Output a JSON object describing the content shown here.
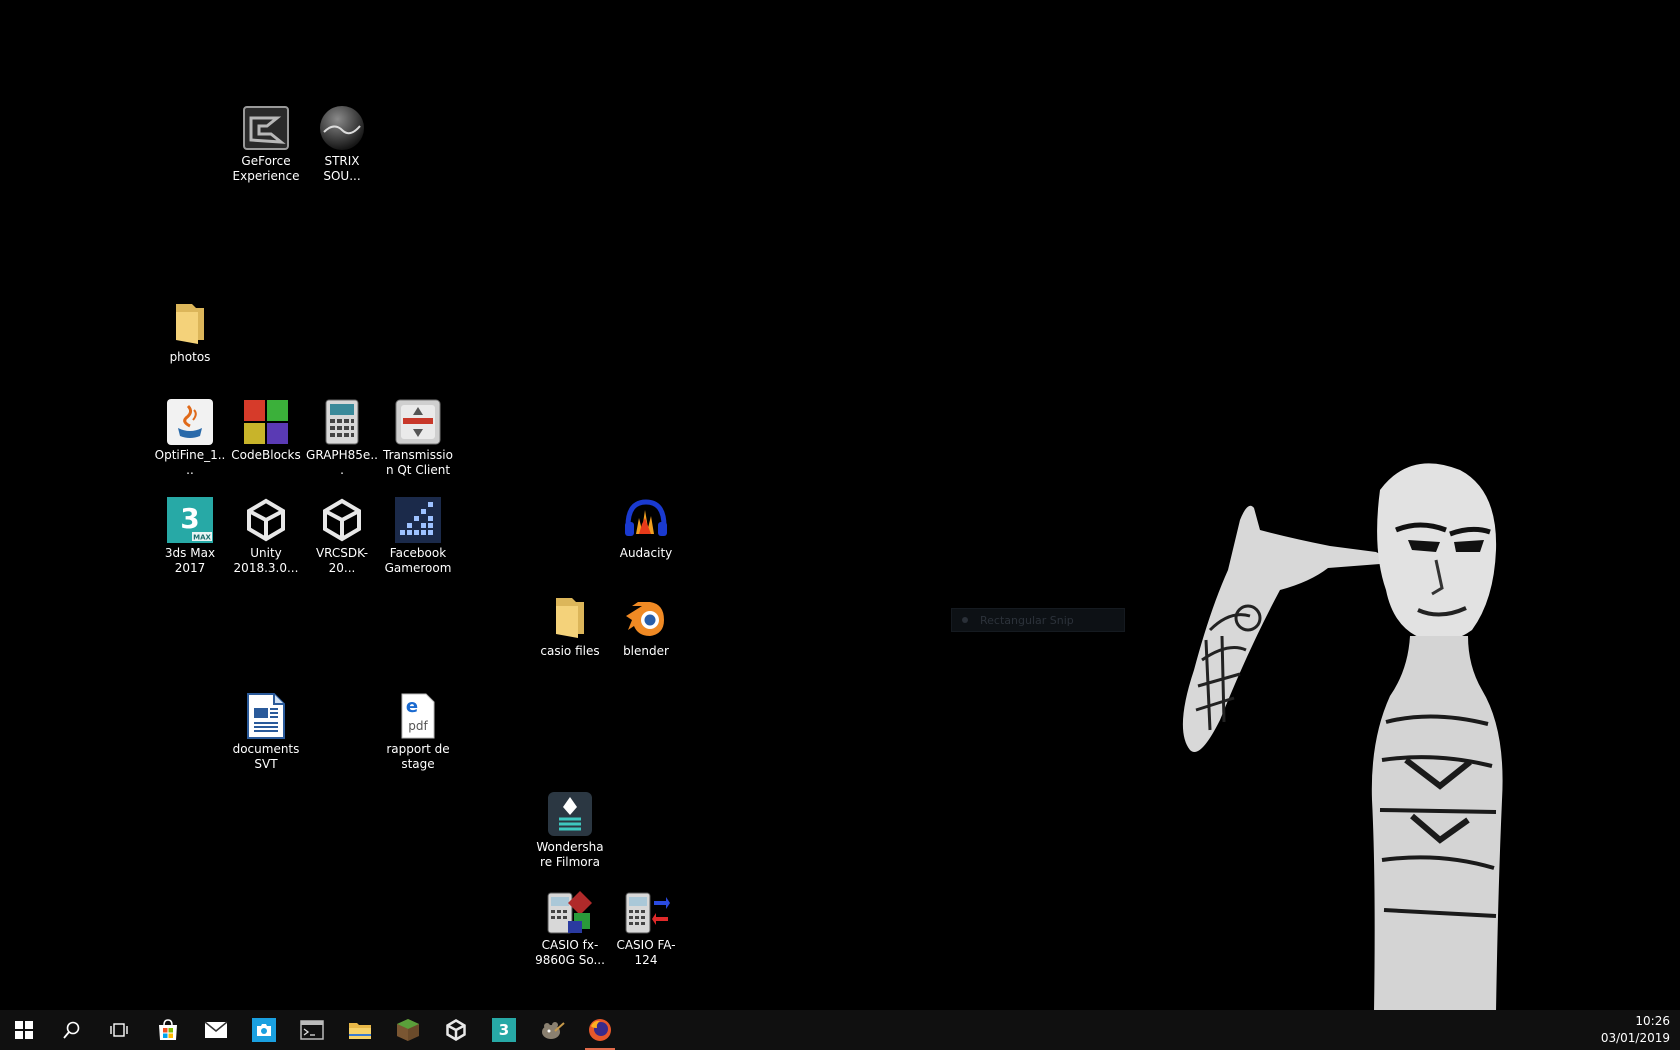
{
  "desktop": {
    "icons": [
      {
        "label": "GeForce Experience",
        "icon": "geforce-experience-icon"
      },
      {
        "label": "STRIX SOU...",
        "icon": "strix-sound-icon"
      },
      {
        "label": "photos",
        "icon": "folder-icon"
      },
      {
        "label": "OptiFine_1....",
        "icon": "java-icon"
      },
      {
        "label": "CodeBlocks",
        "icon": "codeblocks-icon"
      },
      {
        "label": "GRAPH85e...",
        "icon": "calculator-icon"
      },
      {
        "label": "Transmission Qt Client",
        "icon": "transmission-icon"
      },
      {
        "label": "3ds Max 2017",
        "icon": "3ds-max-icon"
      },
      {
        "label": "Unity 2018.3.0...",
        "icon": "unity-icon"
      },
      {
        "label": "VRCSDK-20...",
        "icon": "unity-package-icon"
      },
      {
        "label": "Facebook Gameroom",
        "icon": "facebook-gameroom-icon"
      },
      {
        "label": "Audacity",
        "icon": "audacity-icon"
      },
      {
        "label": "casio files",
        "icon": "folder-icon"
      },
      {
        "label": "blender",
        "icon": "blender-icon"
      },
      {
        "label": "documents SVT",
        "icon": "writer-document-icon"
      },
      {
        "label": "rapport de stage",
        "icon": "edge-pdf-icon"
      },
      {
        "label": "Wondershare Filmora",
        "icon": "filmora-icon"
      },
      {
        "label": "CASIO fx-9860G So...",
        "icon": "casio-fx-icon"
      },
      {
        "label": "CASIO FA-124",
        "icon": "casio-fa-icon"
      }
    ]
  },
  "snip": {
    "label": "Rectangular Snip"
  },
  "taskbar": {
    "items": [
      {
        "icon": "windows-start-icon"
      },
      {
        "icon": "search-icon"
      },
      {
        "icon": "task-view-icon"
      },
      {
        "icon": "store-icon"
      },
      {
        "icon": "mail-icon"
      },
      {
        "icon": "camera-icon"
      },
      {
        "icon": "terminal-icon"
      },
      {
        "icon": "file-explorer-icon"
      },
      {
        "icon": "minecraft-icon"
      },
      {
        "icon": "unity-icon"
      },
      {
        "icon": "3ds-max-icon"
      },
      {
        "icon": "gimp-icon"
      },
      {
        "icon": "firefox-icon"
      }
    ],
    "clock": {
      "time": "10:26",
      "date": "03/01/2019"
    }
  },
  "colors": {
    "desktop_bg": "#000000",
    "taskbar_bg": "#101010",
    "active_indicator": "#e06a4a",
    "folder": "#f4d27a"
  }
}
